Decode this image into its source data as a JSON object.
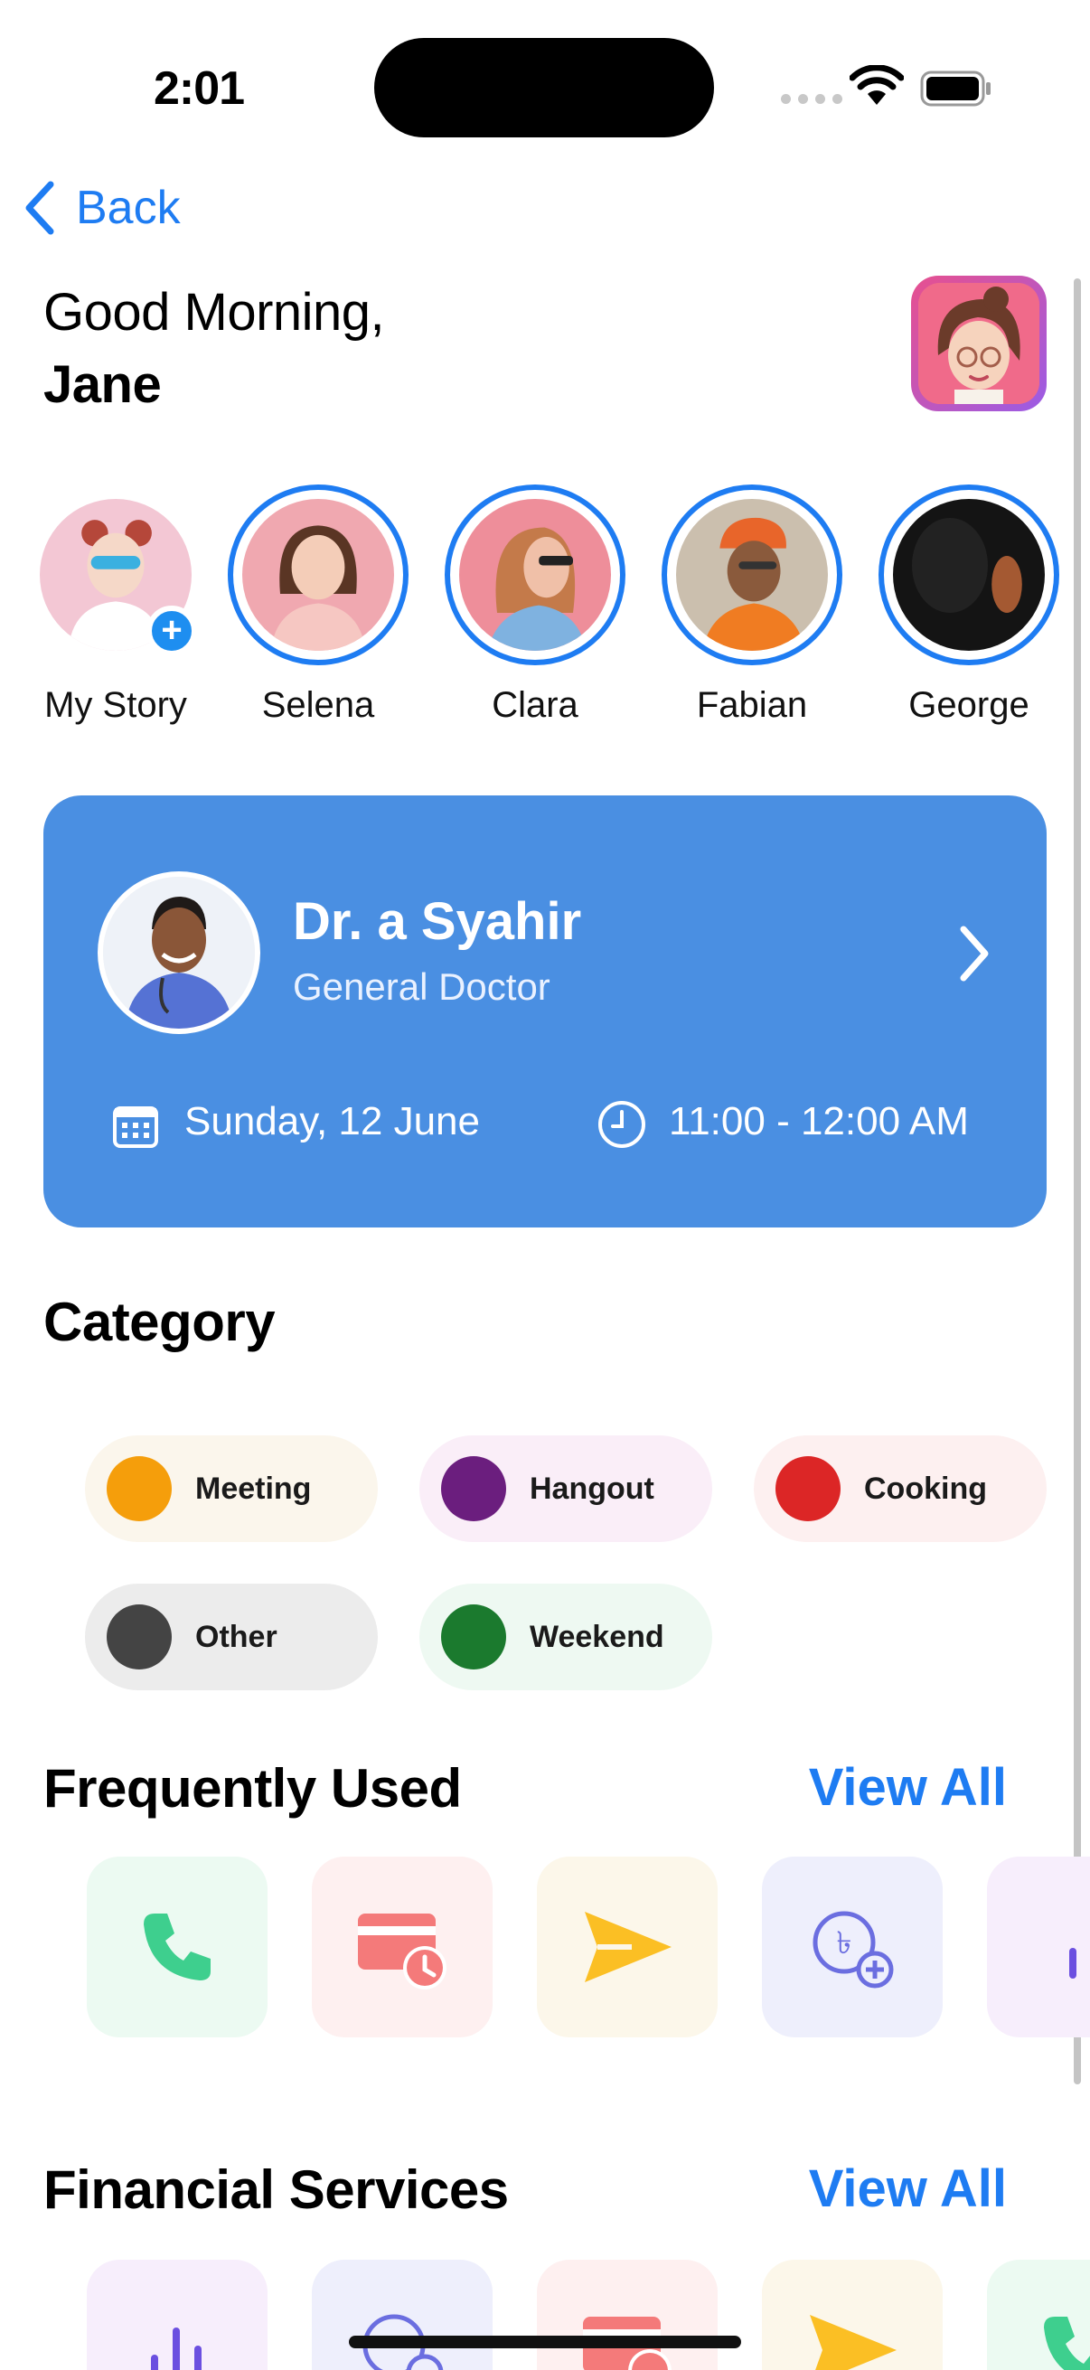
{
  "status_bar": {
    "time": "2:01"
  },
  "nav": {
    "back_label": "Back"
  },
  "greeting": {
    "line1": "Good Morning,",
    "name": "Jane"
  },
  "stories": [
    {
      "label": "My Story",
      "own": true
    },
    {
      "label": "Selena"
    },
    {
      "label": "Clara"
    },
    {
      "label": "Fabian"
    },
    {
      "label": "George"
    }
  ],
  "appointment": {
    "doctor_name": "Dr. a Syahir",
    "doctor_role": "General Doctor",
    "date": "Sunday, 12 June",
    "time": "11:00 - 12:00 AM",
    "card_color": "#4A8FE2"
  },
  "category": {
    "title": "Category",
    "chips": [
      {
        "label": "Meeting",
        "color": "#F59E0B",
        "bg": "#FBF6EC"
      },
      {
        "label": "Hangout",
        "color": "#6B1E7E",
        "bg": "#FAEEF8"
      },
      {
        "label": "Cooking",
        "color": "#DC2626",
        "bg": "#FDF0F0"
      },
      {
        "label": "Other",
        "color": "#444444",
        "bg": "#ECECEC"
      },
      {
        "label": "Weekend",
        "color": "#1B7A2E",
        "bg": "#EEF9F2"
      }
    ]
  },
  "frequently_used": {
    "title": "Frequently Used",
    "view_all": "View All",
    "tiles": [
      "phone-icon",
      "card-schedule-icon",
      "send-icon",
      "currency-add-icon",
      "chart-icon"
    ]
  },
  "financial_services": {
    "title": "Financial Services",
    "view_all": "View All",
    "tiles": [
      "chart-icon",
      "currency-add-icon",
      "card-schedule-icon",
      "send-icon",
      "phone-icon"
    ]
  },
  "colors": {
    "accent": "#1E7CF2"
  }
}
